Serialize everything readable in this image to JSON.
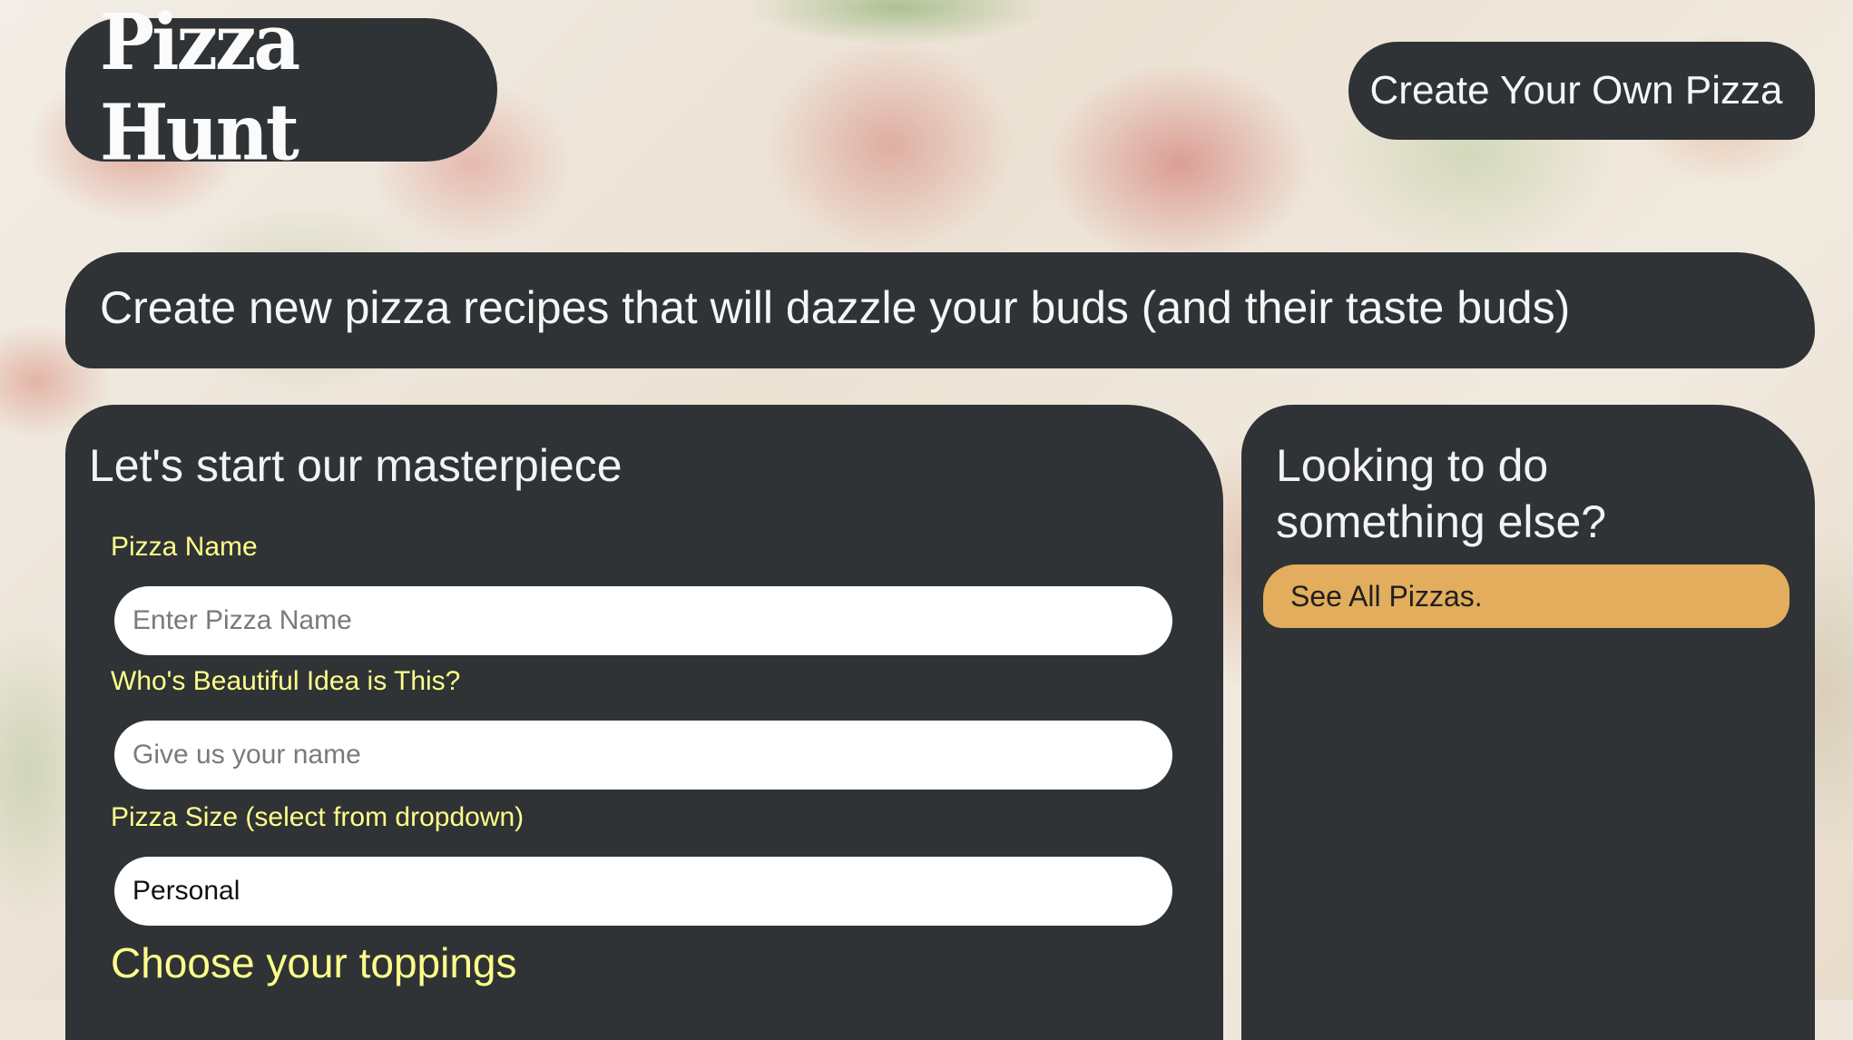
{
  "header": {
    "logo_text": "Pizza Hunt",
    "nav_button_label": "Create Your Own Pizza"
  },
  "tagline": "Create new pizza recipes that will dazzle your buds (and their taste buds)",
  "form": {
    "title": "Let's start our masterpiece",
    "pizza_name": {
      "label": "Pizza Name",
      "placeholder": "Enter Pizza Name"
    },
    "created_by": {
      "label": "Who's Beautiful Idea is This?",
      "placeholder": "Give us your name"
    },
    "pizza_size": {
      "label": "Pizza Size (select from dropdown)",
      "selected": "Personal"
    },
    "toppings_heading": "Choose your toppings"
  },
  "sidebar": {
    "title": "Looking to do something else?",
    "link_label": "See All Pizzas."
  },
  "colors": {
    "panel": "#2f3336",
    "label_accent": "#ffff8a",
    "link_button": "#e2ad5c",
    "input_bg": "#ffffff"
  }
}
